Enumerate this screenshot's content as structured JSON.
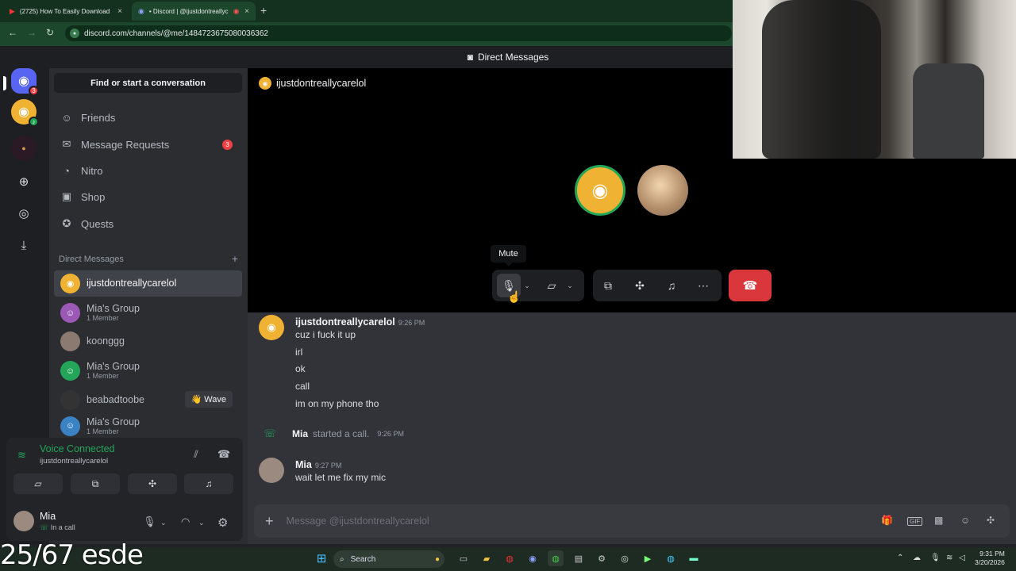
{
  "browser": {
    "tabs": [
      {
        "title": "(2725) How To Easily Download",
        "icon": "youtube-icon"
      },
      {
        "title": "• Discord | @ijustdontreallyc",
        "icon": "discord-icon"
      }
    ],
    "url": "discord.com/channels/@me/1484723675080036362"
  },
  "topbar": {
    "title": "Direct Messages"
  },
  "rail": {
    "dm_badge": "3"
  },
  "sidebar": {
    "search": "Find or start a conversation",
    "nav": [
      {
        "label": "Friends",
        "icon": "friends-icon"
      },
      {
        "label": "Message Requests",
        "icon": "mail-icon",
        "badge": "3"
      },
      {
        "label": "Nitro",
        "icon": "nitro-icon"
      },
      {
        "label": "Shop",
        "icon": "shop-icon"
      },
      {
        "label": "Quests",
        "icon": "quests-icon"
      }
    ],
    "dm_header": "Direct Messages",
    "dms": [
      {
        "name": "ijustdontreallycarelol",
        "sub": ""
      },
      {
        "name": "Mia's Group",
        "sub": "1 Member"
      },
      {
        "name": "koonggg",
        "sub": ""
      },
      {
        "name": "Mia's Group",
        "sub": "1 Member"
      },
      {
        "name": "beabadtoobe",
        "sub": "",
        "wave": "Wave"
      },
      {
        "name": "Mia's Group",
        "sub": "1 Member"
      }
    ]
  },
  "voice": {
    "status": "Voice Connected",
    "channel": "ijustdontreallycarelol"
  },
  "user": {
    "name": "Mia",
    "status": "In a call"
  },
  "call": {
    "name": "ijustdontreallycarelol",
    "tooltip": "Mute"
  },
  "chat": {
    "group1": {
      "author": "ijustdontreallycarelol",
      "time": "9:26 PM",
      "lines": [
        "cuz i fuck it up",
        "irl",
        "ok",
        "call",
        "im on my phone tho"
      ]
    },
    "system": {
      "author": "Mia",
      "text": "started a call.",
      "time": "9:26 PM"
    },
    "group2": {
      "author": "Mia",
      "time": "9:27 PM",
      "lines": [
        "wait let me fix my mic"
      ]
    },
    "composer_placeholder": "Message @ijustdontreallycarelol"
  },
  "overlay": "25/67 esde",
  "taskbar": {
    "search": "Search",
    "time": "9:31 PM",
    "date": "3/20/2026"
  },
  "colors": {
    "accent": "#5865f2",
    "online": "#23a55a",
    "danger": "#da373c",
    "yellow": "#f0b232"
  }
}
